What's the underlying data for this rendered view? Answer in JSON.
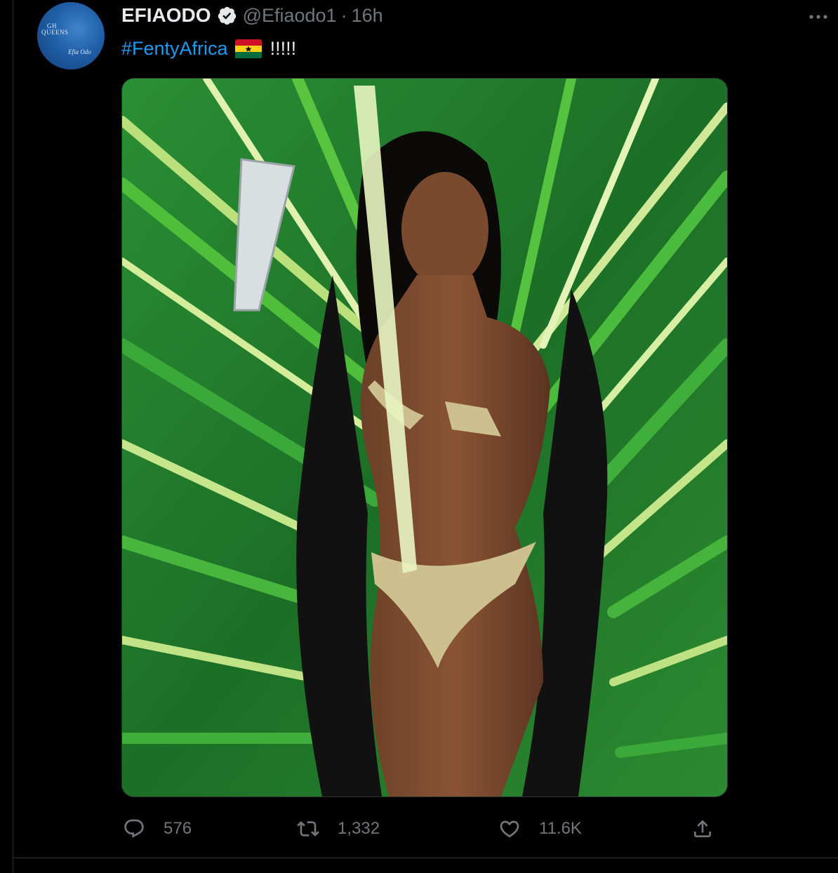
{
  "tweet": {
    "display_name": "EFIAODO",
    "handle": "@Efiaodo1",
    "separator": "·",
    "timestamp": "16h",
    "hashtag": "#FentyAfrica",
    "text_suffix": "!!!!!",
    "flag_icon": "ghana-flag-icon",
    "avatar": {
      "label": "GH QUEENS",
      "signature": "Efia Odo"
    },
    "media_description": "photo"
  },
  "actions": {
    "reply": {
      "icon": "reply-icon",
      "count": "576"
    },
    "retweet": {
      "icon": "retweet-icon",
      "count": "1,332"
    },
    "like": {
      "icon": "heart-icon",
      "count": "11.6K"
    },
    "share": {
      "icon": "share-icon"
    }
  },
  "colors": {
    "background": "#000000",
    "text_primary": "#e7e9ea",
    "text_secondary": "#71767b",
    "accent": "#1d9bf0",
    "border": "#2f3336"
  }
}
